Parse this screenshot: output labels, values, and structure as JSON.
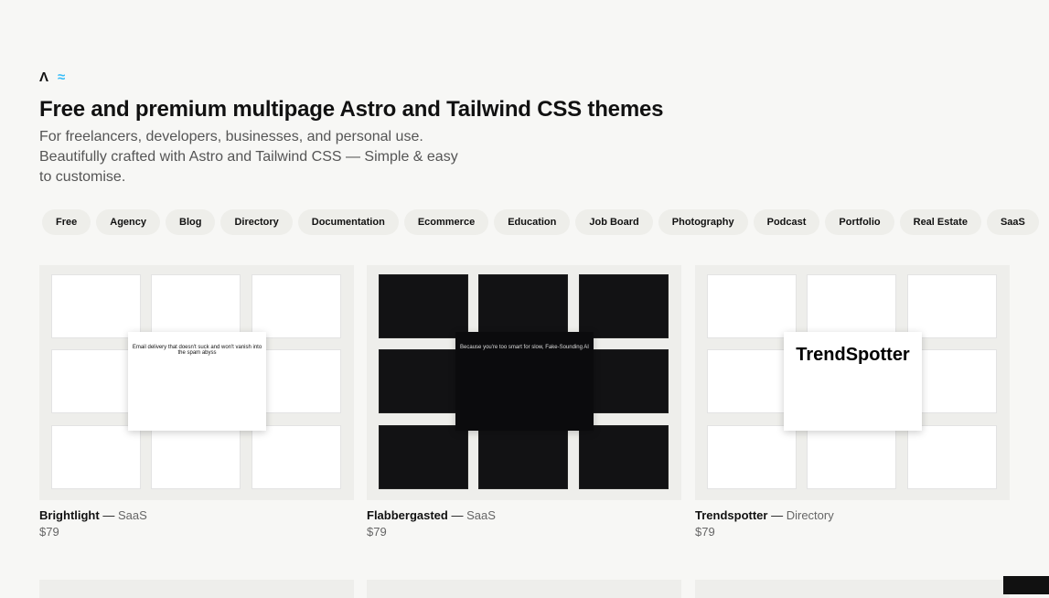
{
  "logos": {
    "astro": "astro-logo",
    "tailwind": "tailwind-logo"
  },
  "title": "Free and premium multipage Astro and Tailwind CSS themes",
  "subtitle": "For freelancers, developers, businesses, and personal use. Beautifully crafted with Astro and Tailwind CSS — Simple & easy to customise.",
  "categories": [
    "Free",
    "Agency",
    "Blog",
    "Directory",
    "Documentation",
    "Ecommerce",
    "Education",
    "Job Board",
    "Photography",
    "Podcast",
    "Portfolio",
    "Real Estate",
    "SaaS"
  ],
  "themes": [
    {
      "name": "Brightlight",
      "sep": "—",
      "category": "SaaS",
      "price": "$79",
      "theme": "light",
      "hero": "Email delivery that doesn't suck and won't vanish into the spam abyss"
    },
    {
      "name": "Flabbergasted",
      "sep": "—",
      "category": "SaaS",
      "price": "$79",
      "theme": "dark",
      "hero": "Because you're too smart for slow, Fake-Sounding AI"
    },
    {
      "name": "Trendspotter",
      "sep": "—",
      "category": "Directory",
      "price": "$79",
      "theme": "light",
      "hero": "TrendSpotter"
    }
  ]
}
